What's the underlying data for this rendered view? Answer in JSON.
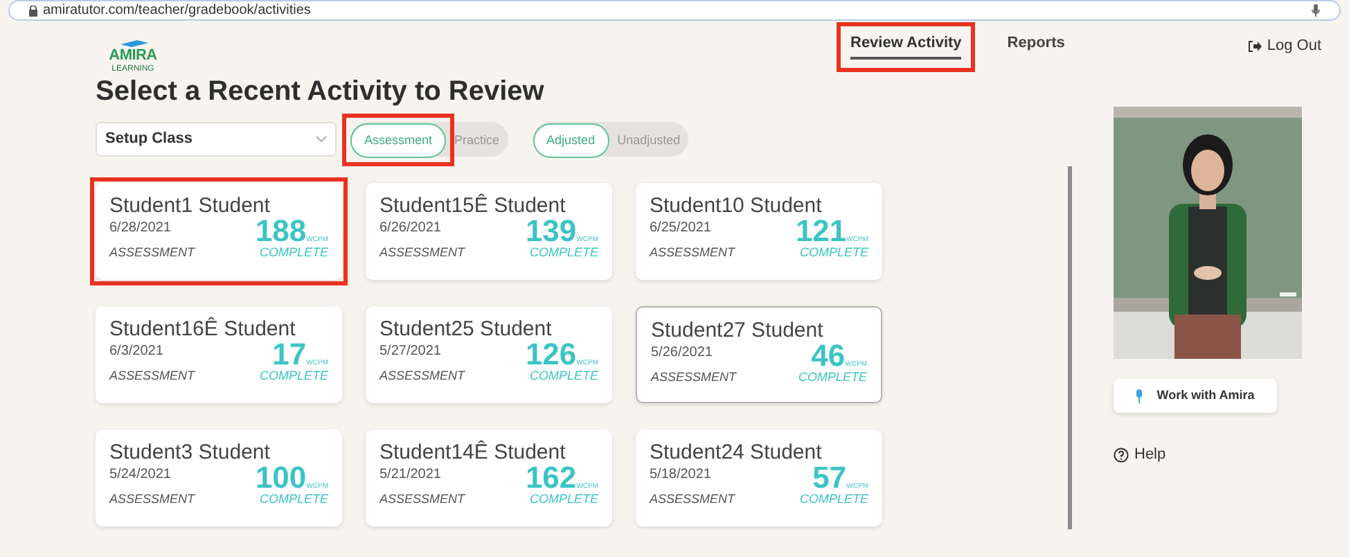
{
  "browser": {
    "url": "amiratutor.com/teacher/gradebook/activities"
  },
  "header": {
    "logo": {
      "text": "AMIRA",
      "subtext": "LEARNING"
    },
    "nav": [
      {
        "label": "Review Activity",
        "selected": true,
        "highlighted": true
      },
      {
        "label": "Reports",
        "selected": false,
        "highlighted": false
      }
    ],
    "logout": "Log Out"
  },
  "title": "Select a Recent Activity to Review",
  "class_select": {
    "value": "Setup Class"
  },
  "toggles": [
    {
      "options": [
        {
          "label": "Assessment",
          "selected": true,
          "highlighted": true
        },
        {
          "label": "Practice",
          "selected": false,
          "highlighted": false
        }
      ]
    },
    {
      "options": [
        {
          "label": "Adjusted",
          "selected": true,
          "highlighted": false
        },
        {
          "label": "Unadjusted",
          "selected": false,
          "highlighted": false
        }
      ]
    }
  ],
  "cards": [
    {
      "name": "Student1 Student",
      "date": "6/28/2021",
      "type": "ASSESSMENT",
      "score": "188",
      "unit": "WCPM",
      "status": "COMPLETE",
      "highlighted": true,
      "hovered": false
    },
    {
      "name": "Student15Ê Student",
      "date": "6/26/2021",
      "type": "ASSESSMENT",
      "score": "139",
      "unit": "WCPM",
      "status": "COMPLETE",
      "highlighted": false,
      "hovered": false
    },
    {
      "name": "Student10 Student",
      "date": "6/25/2021",
      "type": "ASSESSMENT",
      "score": "121",
      "unit": "WCPM",
      "status": "COMPLETE",
      "highlighted": false,
      "hovered": false
    },
    {
      "name": "Student16Ê Student",
      "date": "6/3/2021",
      "type": "ASSESSMENT",
      "score": "17",
      "unit": "WCPM",
      "status": "COMPLETE",
      "highlighted": false,
      "hovered": false
    },
    {
      "name": "Student25 Student",
      "date": "5/27/2021",
      "type": "ASSESSMENT",
      "score": "126",
      "unit": "WCPM",
      "status": "COMPLETE",
      "highlighted": false,
      "hovered": false
    },
    {
      "name": "Student27 Student",
      "date": "5/26/2021",
      "type": "ASSESSMENT",
      "score": "46",
      "unit": "WCPM",
      "status": "COMPLETE",
      "highlighted": false,
      "hovered": true
    },
    {
      "name": "Student3 Student",
      "date": "5/24/2021",
      "type": "ASSESSMENT",
      "score": "100",
      "unit": "WCPM",
      "status": "COMPLETE",
      "highlighted": false,
      "hovered": false
    },
    {
      "name": "Student14Ê Student",
      "date": "5/21/2021",
      "type": "ASSESSMENT",
      "score": "162",
      "unit": "WCPM",
      "status": "COMPLETE",
      "highlighted": false,
      "hovered": false
    },
    {
      "name": "Student24 Student",
      "date": "5/18/2021",
      "type": "ASSESSMENT",
      "score": "57",
      "unit": "WCPM",
      "status": "COMPLETE",
      "highlighted": false,
      "hovered": false
    }
  ],
  "sidebar": {
    "work_button": "Work with Amira",
    "help": "Help"
  }
}
